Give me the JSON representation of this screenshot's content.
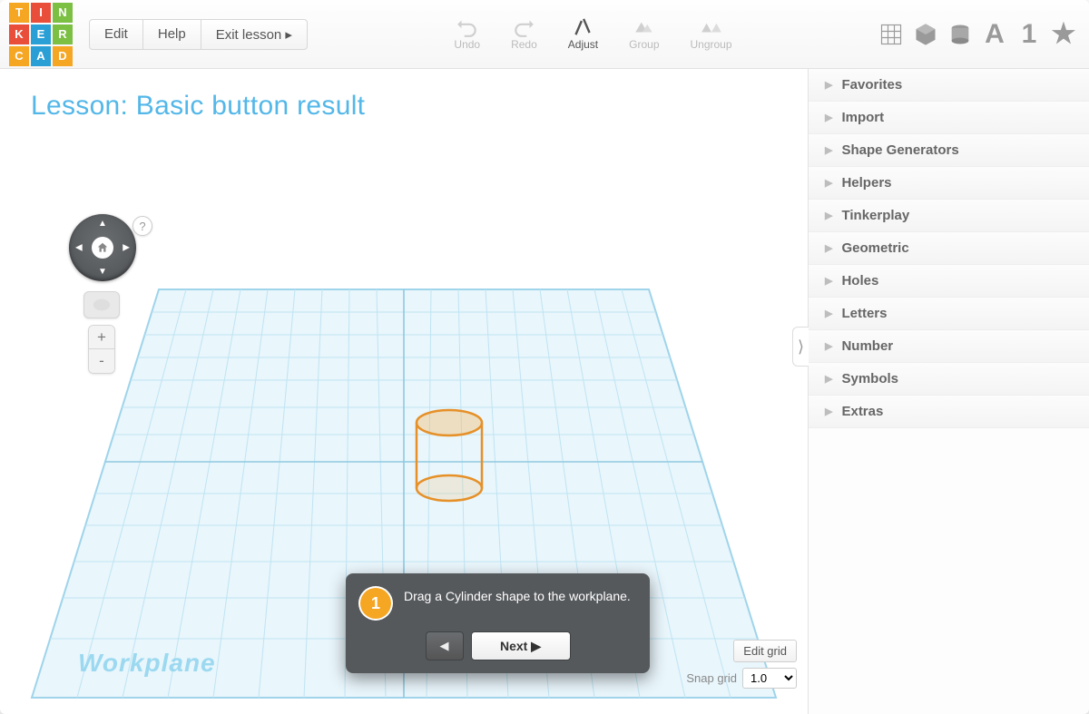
{
  "menu": {
    "edit": "Edit",
    "help": "Help",
    "exit": "Exit lesson ▸"
  },
  "tools": {
    "undo": "Undo",
    "redo": "Redo",
    "adjust": "Adjust",
    "group": "Group",
    "ungroup": "Ungroup"
  },
  "lesson_title": "Lesson: Basic button result",
  "workplane_label": "Workplane",
  "tutorial": {
    "step": "1",
    "text": "Drag a Cylinder shape to the workplane.",
    "prev": "◀",
    "next": "Next ▶"
  },
  "grid": {
    "edit_label": "Edit grid",
    "snap_label": "Snap grid",
    "snap_value": "1.0"
  },
  "categories": [
    "Favorites",
    "Import",
    "Shape Generators",
    "Helpers",
    "Tinkerplay",
    "Geometric",
    "Holes",
    "Letters",
    "Number",
    "Symbols",
    "Extras"
  ],
  "logo": [
    "T",
    "I",
    "N",
    "K",
    "E",
    "R",
    "C",
    "A",
    "D"
  ],
  "help_bubble": "?",
  "zoom": {
    "in": "+",
    "out": "-"
  },
  "collapse": "⟩",
  "side_glyphs": {
    "A": "A",
    "one": "1",
    "star": "★"
  }
}
